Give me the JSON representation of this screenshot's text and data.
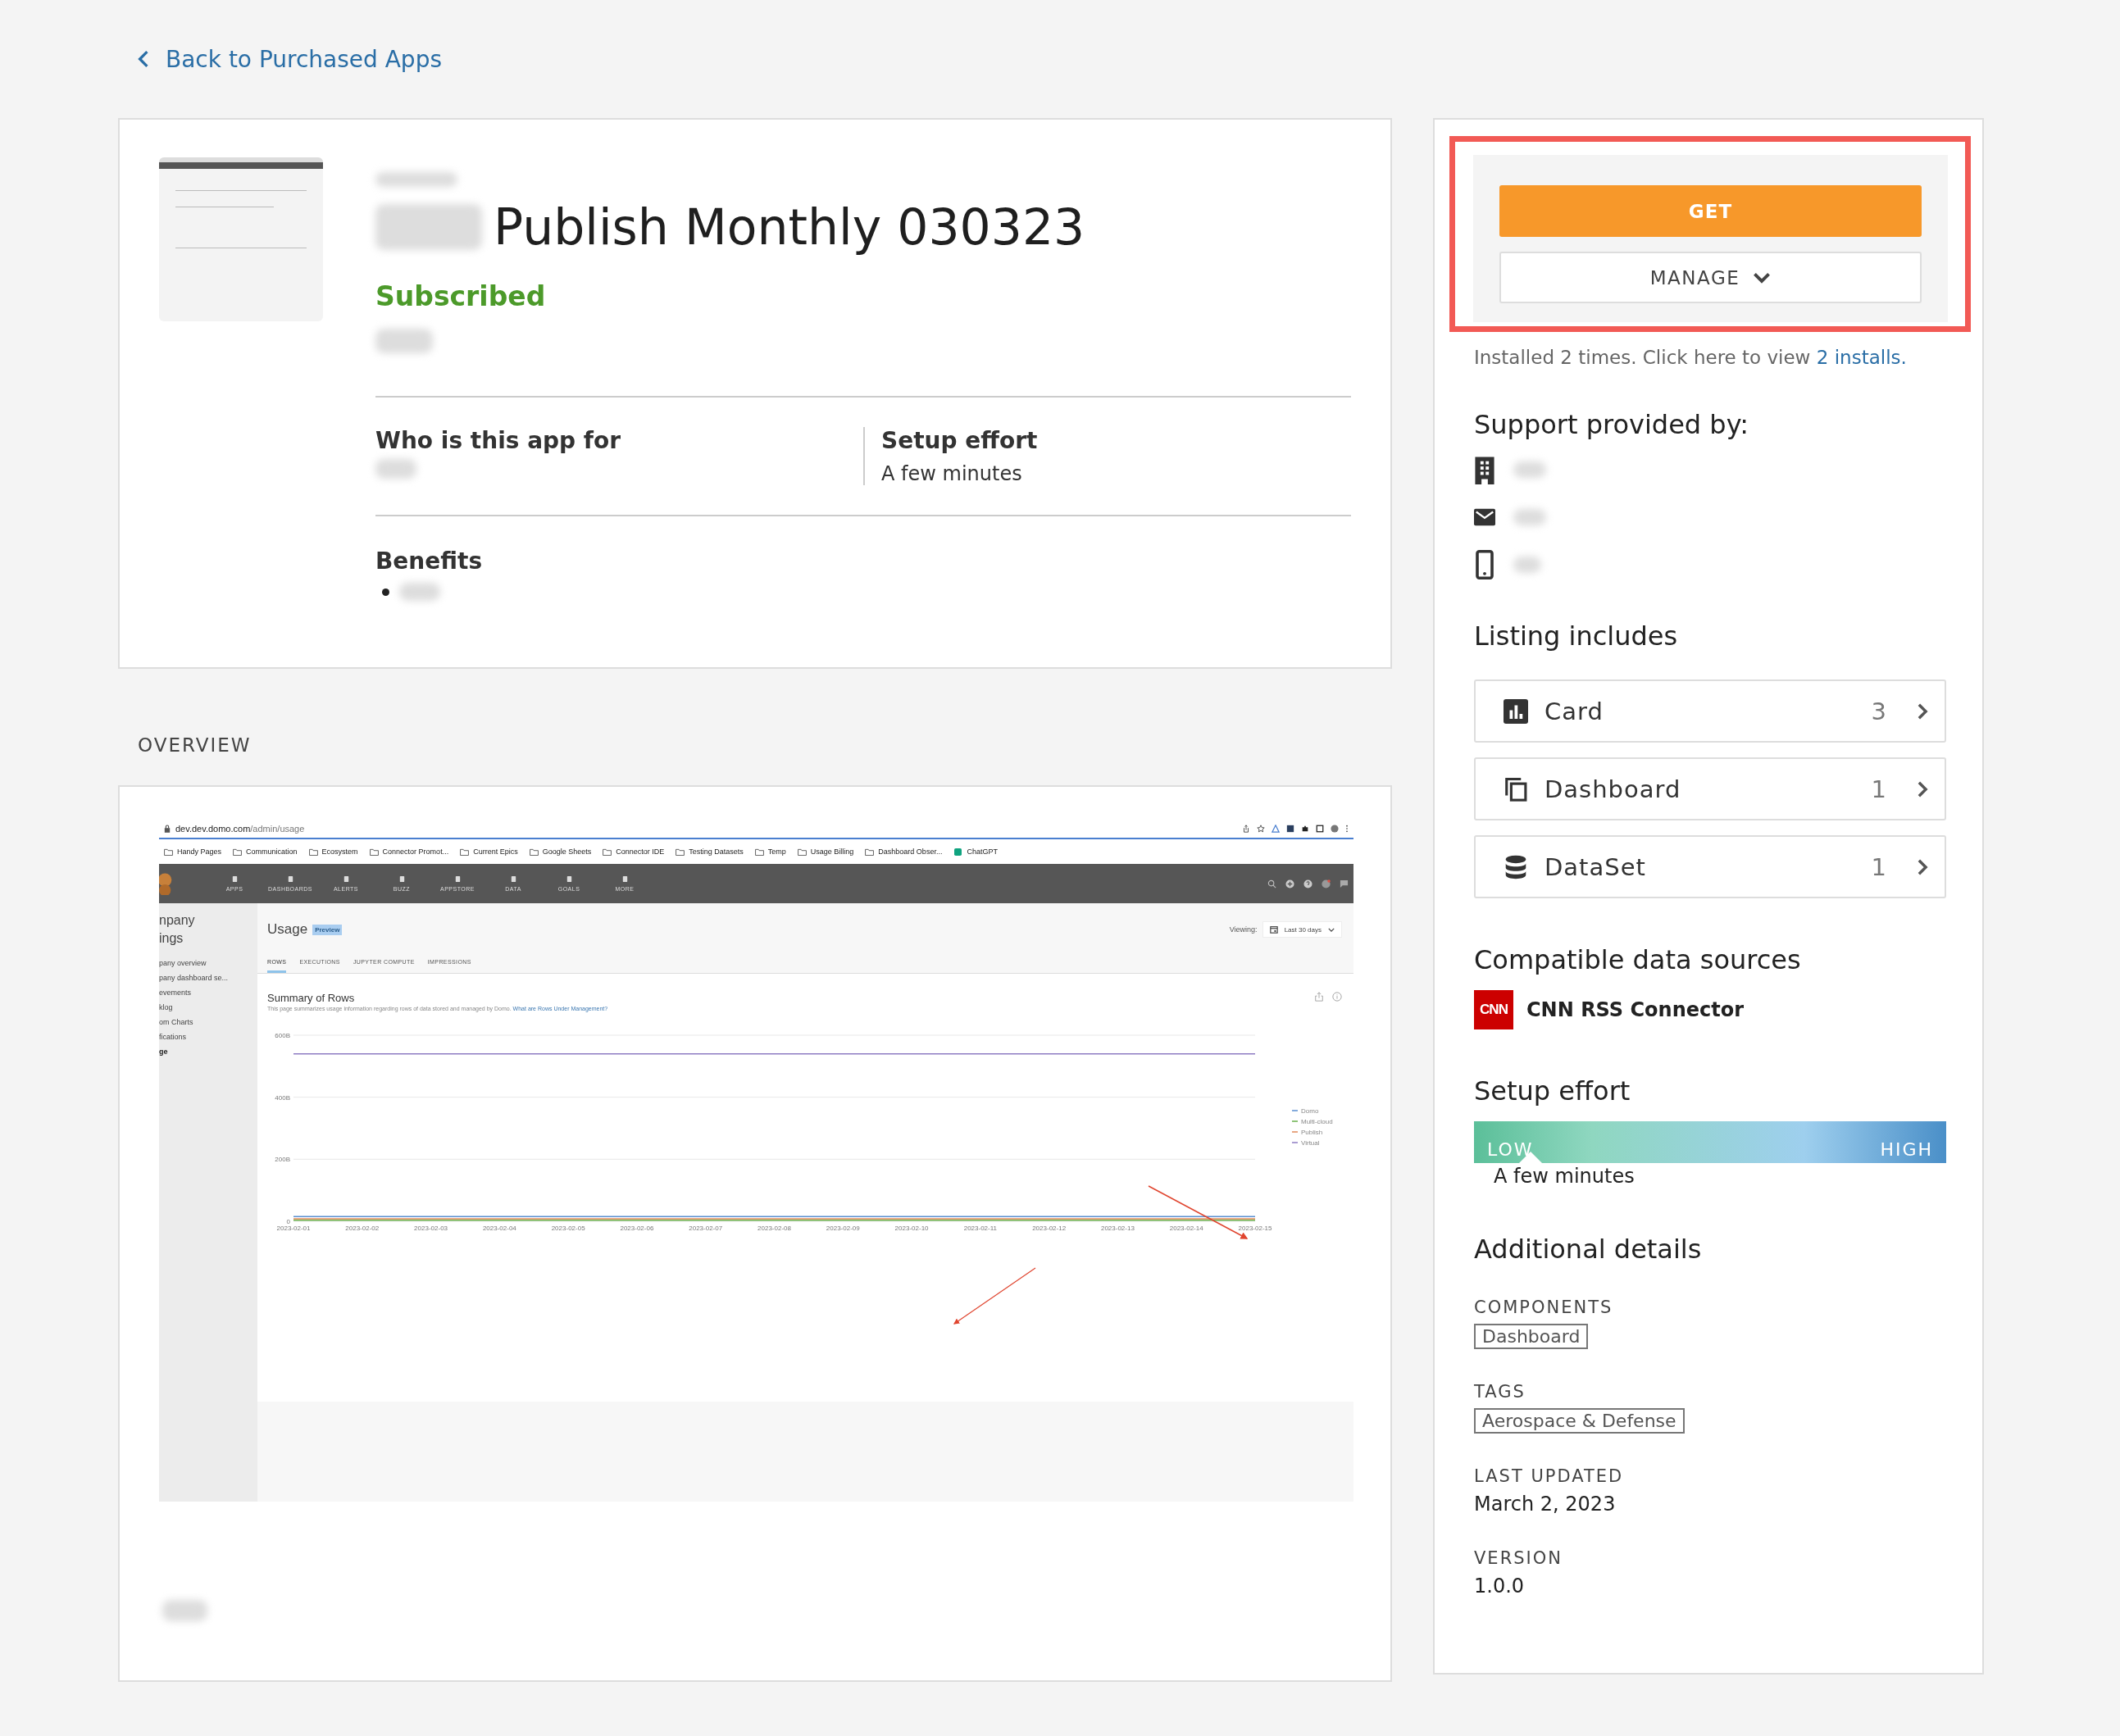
{
  "back_link": "Back to Purchased Apps",
  "app": {
    "title": "Publish Monthly 030323",
    "status": "Subscribed",
    "info": [
      {
        "heading": "Who is this app for"
      },
      {
        "heading": "Setup effort",
        "value": "A few minutes"
      }
    ],
    "benefits_heading": "Benefits"
  },
  "overview": {
    "label": "OVERVIEW",
    "screenshot": {
      "url_host": "dev.dev.domo.com",
      "url_path": "/admin/usage",
      "bookmarks": [
        {
          "kind": "folder",
          "label": "Handy Pages"
        },
        {
          "kind": "folder",
          "label": "Communication"
        },
        {
          "kind": "folder",
          "label": "Ecosystem"
        },
        {
          "kind": "folder",
          "label": "Connector Promot..."
        },
        {
          "kind": "folder",
          "label": "Current Epics"
        },
        {
          "kind": "folder",
          "label": "Google Sheets"
        },
        {
          "kind": "folder",
          "label": "Connector IDE"
        },
        {
          "kind": "folder",
          "label": "Testing Datasets"
        },
        {
          "kind": "folder",
          "label": "Temp"
        },
        {
          "kind": "folder",
          "label": "Usage Billing"
        },
        {
          "kind": "folder",
          "label": "Dashboard Obser..."
        },
        {
          "kind": "site",
          "label": "ChatGPT"
        }
      ],
      "nav": [
        "APPS",
        "DASHBOARDS",
        "ALERTS",
        "BUZZ",
        "APPSTORE",
        "DATA",
        "GOALS",
        "MORE"
      ],
      "sidebar_title": [
        "npany",
        "ings"
      ],
      "sidebar": [
        {
          "label": "pany overview",
          "selected": false
        },
        {
          "label": "pany dashboard se...",
          "selected": false
        },
        {
          "label": "evements",
          "selected": false
        },
        {
          "label": "klog",
          "selected": false
        },
        {
          "label": "om Charts",
          "selected": false
        },
        {
          "label": "fications",
          "selected": false
        },
        {
          "label": "ge",
          "selected": true
        }
      ],
      "page_title": "Usage",
      "badge": "Preview",
      "viewing_label": "Viewing:",
      "range": "Last 30 days",
      "tabs": [
        {
          "label": "ROWS",
          "selected": true
        },
        {
          "label": "EXECUTIONS",
          "selected": false
        },
        {
          "label": "JUPYTER COMPUTE",
          "selected": false
        },
        {
          "label": "IMPRESSIONS",
          "selected": false
        }
      ],
      "summary_title": "Summary of Rows",
      "summary_text": "This page summarizes usage information regarding rows of data stored and managed by Domo. ",
      "summary_link": "What are Rows Under Management?",
      "chart_data": {
        "type": "line",
        "x": [
          "2023-02-01",
          "2023-02-02",
          "2023-02-03",
          "2023-02-04",
          "2023-02-05",
          "2023-02-06",
          "2023-02-07",
          "2023-02-08",
          "2023-02-09",
          "2023-02-10",
          "2023-02-11",
          "2023-02-12",
          "2023-02-13",
          "2023-02-14",
          "2023-02-15"
        ],
        "series": [
          {
            "name": "Domo",
            "color": "#5b8fd0",
            "values": [
              15,
              15,
              15,
              15,
              15,
              15,
              15,
              15,
              15,
              15,
              15,
              15,
              15,
              15,
              15
            ]
          },
          {
            "name": "Multi-cloud",
            "color": "#6ab04c",
            "values": [
              3,
              3,
              3,
              3,
              3,
              3,
              3,
              3,
              3,
              3,
              3,
              3,
              3,
              3,
              3
            ]
          },
          {
            "name": "Publish",
            "color": "#e08a5a",
            "values": [
              8,
              8,
              8,
              8,
              8,
              8,
              8,
              8,
              8,
              8,
              8,
              8,
              8,
              8,
              8
            ]
          },
          {
            "name": "Virtual",
            "color": "#8e7cc3",
            "values": [
              540,
              540,
              540,
              540,
              540,
              540,
              540,
              540,
              540,
              540,
              540,
              540,
              540,
              540,
              540
            ]
          }
        ],
        "ylim": [
          0,
          600
        ],
        "legend": true,
        "yticks": [
          {
            "value": 0,
            "label": "0"
          },
          {
            "value": 200,
            "label": "200B"
          },
          {
            "value": 400,
            "label": "400B"
          },
          {
            "value": 600,
            "label": "600B"
          }
        ]
      }
    }
  },
  "actions": {
    "get": "GET",
    "manage": "MANAGE",
    "installed_text": "Installed 2 times. Click here to view ",
    "installs_link": "2 installs."
  },
  "support_heading": "Support provided by:",
  "listing": {
    "heading": "Listing includes",
    "items": [
      {
        "kind": "card",
        "label": "Card",
        "count": "3"
      },
      {
        "kind": "dashboard",
        "label": "Dashboard",
        "count": "1"
      },
      {
        "kind": "dataset",
        "label": "DataSet",
        "count": "1"
      }
    ]
  },
  "data_sources": {
    "heading": "Compatible data sources",
    "items": [
      {
        "logo": "CNN",
        "name": "CNN RSS Connector"
      }
    ]
  },
  "setup_effort": {
    "heading": "Setup effort",
    "low": "LOW",
    "high": "HIGH",
    "level": 0.12,
    "value": "A few minutes"
  },
  "additional": {
    "heading": "Additional details",
    "sections": [
      {
        "label": "COMPONENTS",
        "tags": [
          "Dashboard"
        ]
      },
      {
        "label": "TAGS",
        "tags": [
          "Aerospace & Defense"
        ]
      },
      {
        "label": "LAST UPDATED",
        "value": "March 2, 2023"
      },
      {
        "label": "VERSION",
        "value": "1.0.0"
      }
    ]
  }
}
